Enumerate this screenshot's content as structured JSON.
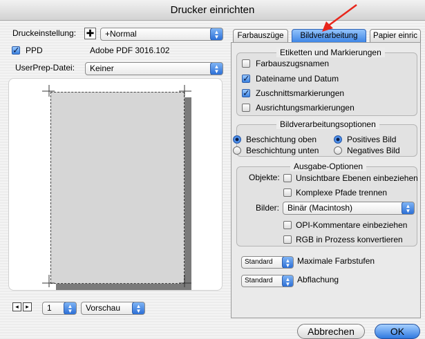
{
  "window": {
    "title": "Drucker einrichten"
  },
  "left": {
    "preset_label": "Druckeinstellung:",
    "preset_value": "+Normal",
    "ppd_label": "PPD",
    "ppd_value": "Adobe PDF 3016.102",
    "userprep_label": "UserPrep-Datei:",
    "userprep_value": "Keiner",
    "page_number": "1",
    "view_value": "Vorschau"
  },
  "tabs": [
    {
      "label": "Farbauszüge"
    },
    {
      "label": "Bildverarbeitung"
    },
    {
      "label": "Papier einric"
    }
  ],
  "group1": {
    "title": "Etiketten und Markierungen",
    "items": [
      {
        "label": "Farbauszugsnamen",
        "checked": false
      },
      {
        "label": "Dateiname und Datum",
        "checked": true
      },
      {
        "label": "Zuschnittsmarkierungen",
        "checked": true
      },
      {
        "label": "Ausrichtungsmarkierungen",
        "checked": false
      }
    ]
  },
  "group2": {
    "title": "Bildverarbeitungsoptionen",
    "radio1": "Beschichtung oben",
    "radio2": "Positives Bild",
    "radio3": "Beschichtung unten",
    "radio4": "Negatives Bild"
  },
  "group3": {
    "title": "Ausgabe-Optionen",
    "objects_label": "Objekte:",
    "objects_opt1": "Unsichtbare Ebenen einbeziehen",
    "objects_opt2": "Komplexe Pfade trennen",
    "images_label": "Bilder:",
    "images_value": "Binär (Macintosh)",
    "images_opt1": "OPI-Kommentare einbeziehen",
    "images_opt2": "RGB in Prozess konvertieren"
  },
  "bottom_options": {
    "max_colors_value": "Standard",
    "max_colors_label": "Maximale Farbstufen",
    "flattening_value": "Standard",
    "flattening_label": "Abflachung"
  },
  "buttons": {
    "cancel": "Abbrechen",
    "ok": "OK"
  },
  "colors": {
    "accent": "#3f86e6",
    "arrow": "#e8261c"
  }
}
